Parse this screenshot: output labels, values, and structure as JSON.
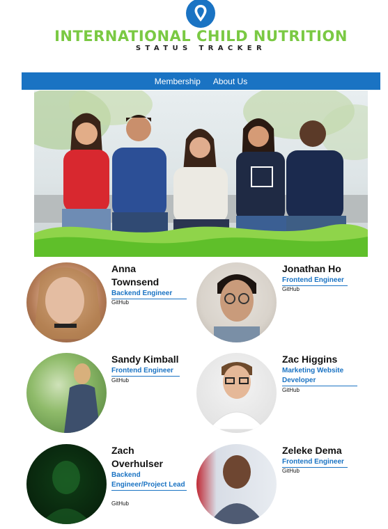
{
  "header": {
    "title": "INTERNATIONAL CHILD NUTRITION",
    "subtitle": "STATUS TRACKER"
  },
  "nav": {
    "items": [
      {
        "label": "Membership"
      },
      {
        "label": "About Us"
      }
    ]
  },
  "colors": {
    "brand_blue": "#1a73c3",
    "brand_green": "#7ac943"
  },
  "team": [
    {
      "name": "Anna Townsend",
      "role": "Backend Engineer",
      "link": "GitHub"
    },
    {
      "name": "Jonathan Ho",
      "role": "Frontend Engineer",
      "link": "GitHub"
    },
    {
      "name": "Sandy Kimball",
      "role": "Frontend Engineer",
      "link": "GitHub"
    },
    {
      "name": "Zac Higgins",
      "role": "Marketing Website Developer",
      "link": "GitHub"
    },
    {
      "name": "Zach Overhulser",
      "role": "Backend Engineer/Project Lead",
      "link": "GitHub"
    },
    {
      "name": "Zeleke Dema",
      "role": "Frontend Engineer",
      "link": "GitHub"
    }
  ]
}
